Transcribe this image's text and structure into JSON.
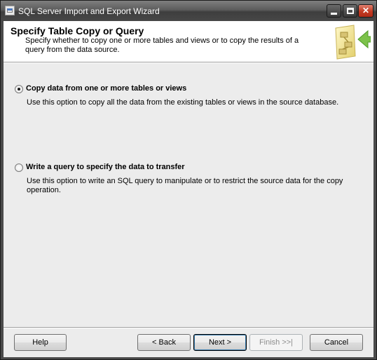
{
  "window": {
    "title": "SQL Server Import and Export Wizard"
  },
  "header": {
    "title": "Specify Table Copy or Query",
    "description": "Specify whether to copy one or more tables and views or to copy the results of a query from the data source."
  },
  "options": [
    {
      "label": "Copy data from one or more tables or views",
      "description": "Use this option to copy all the data from the existing tables or views in the source database.",
      "selected": true
    },
    {
      "label": "Write a query to specify the data to transfer",
      "description": "Use this option to write an SQL query to manipulate or to restrict the source data for the copy operation.",
      "selected": false
    }
  ],
  "buttons": {
    "help": "Help",
    "back": "< Back",
    "next": "Next >",
    "finish": "Finish >>|",
    "cancel": "Cancel"
  }
}
